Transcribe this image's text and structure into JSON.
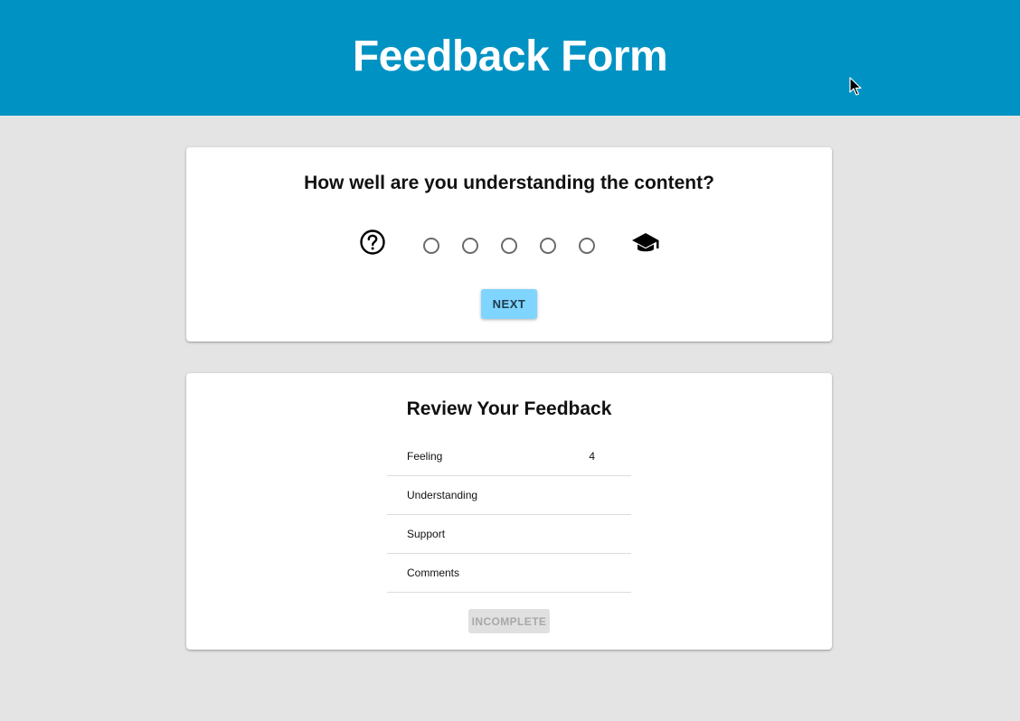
{
  "header": {
    "title": "Feedback Form"
  },
  "question_card": {
    "question": "How well are you understanding the content?",
    "scale": {
      "low_icon": "help-circle-icon",
      "high_icon": "graduation-cap-icon",
      "option_count": 5,
      "selected": null
    },
    "next_label": "NEXT"
  },
  "review_card": {
    "title": "Review Your Feedback",
    "rows": [
      {
        "label": "Feeling",
        "value": "4"
      },
      {
        "label": "Understanding",
        "value": ""
      },
      {
        "label": "Support",
        "value": ""
      },
      {
        "label": "Comments",
        "value": ""
      }
    ],
    "submit_label": "INCOMPLETE"
  },
  "colors": {
    "header_bg": "#0092c3",
    "next_button": "#7fd5ff",
    "page_bg": "#e4e4e4"
  }
}
